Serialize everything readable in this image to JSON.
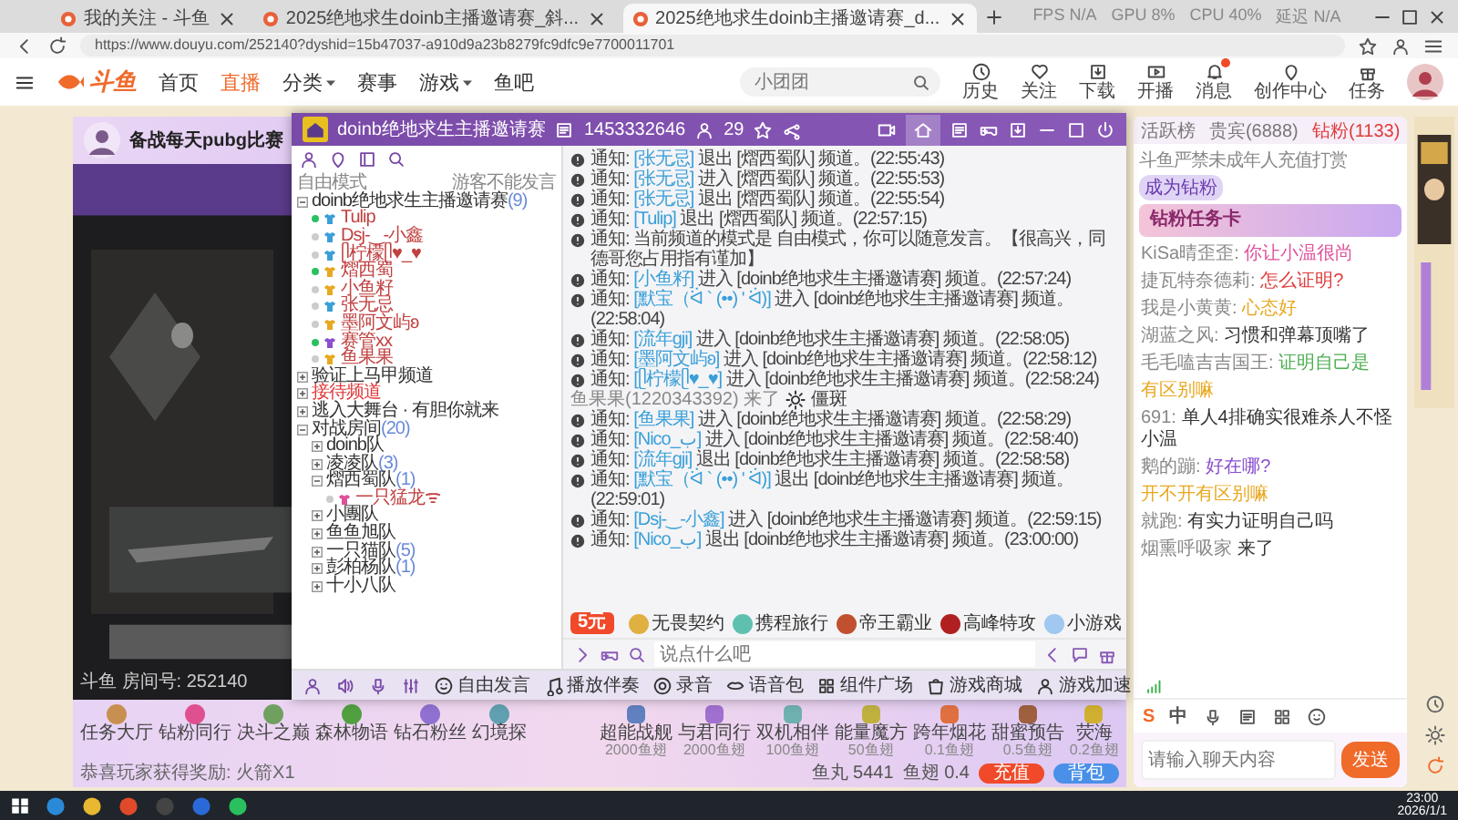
{
  "browser": {
    "tabs": [
      {
        "title": "我的关注 - 斗鱼",
        "selected": false
      },
      {
        "title": "2025绝地求生doinb主播邀请赛_斜...",
        "selected": false
      },
      {
        "title": "2025绝地求生doinb主播邀请赛_d...",
        "selected": true
      }
    ],
    "overlay_stats": [
      "FPS N/A",
      "GPU 8%",
      "CPU 40%",
      "延迟 N/A"
    ],
    "url": "https://www.douyu.com/252140?dyshid=15b47037-a910d9a23b8279fc9dfc9e7700011701"
  },
  "site": {
    "logo": "斗鱼",
    "nav": [
      {
        "label": "首页",
        "selected": false,
        "dropdown": false
      },
      {
        "label": "直播",
        "selected": true,
        "dropdown": false
      },
      {
        "label": "分类",
        "selected": false,
        "dropdown": true
      },
      {
        "label": "赛事",
        "selected": false,
        "dropdown": false
      },
      {
        "label": "游戏",
        "selected": false,
        "dropdown": true
      },
      {
        "label": "鱼吧",
        "selected": false,
        "dropdown": false
      }
    ],
    "search": {
      "placeholder": "小团团"
    },
    "actions": [
      {
        "label": "历史",
        "badge": false
      },
      {
        "label": "关注",
        "badge": false
      },
      {
        "label": "下载",
        "badge": false
      },
      {
        "label": "开播",
        "badge": false
      },
      {
        "label": "消息",
        "badge": true
      },
      {
        "label": "创作中心",
        "badge": false
      },
      {
        "label": "任务",
        "badge": false
      }
    ]
  },
  "room": {
    "streamer": "备战每天pubg比赛",
    "room_line": "斗鱼 房间号: 252140",
    "gifts_left": [
      "任务大厅",
      "钻粉同行",
      "决斗之巅",
      "森林物语",
      "钻石粉丝",
      "幻境探"
    ],
    "gifts_right": [
      {
        "name": "超能战舰",
        "price": "2000鱼翅"
      },
      {
        "name": "与君同行",
        "price": "2000鱼翅"
      },
      {
        "name": "双机相伴",
        "price": "100鱼翅"
      },
      {
        "name": "能量魔方",
        "price": "50鱼翅"
      },
      {
        "name": "跨年烟花",
        "price": "0.1鱼翅"
      },
      {
        "name": "甜蜜预告",
        "price": "0.5鱼翅"
      },
      {
        "name": "荧海",
        "price": "0.2鱼翅"
      }
    ],
    "reward_notice": "恭喜玩家获得奖励: 火箭X1",
    "fish_balls": "鱼丸 5441",
    "fish_fins": "鱼翅 0.4",
    "recharge": "充值",
    "backpack": "背包"
  },
  "voice_app": {
    "title": "doinb绝地求生主播邀请赛",
    "room_id": "1453332646",
    "online": "29",
    "mode": "自由模式",
    "mode_note": "游客不能发言",
    "channels": [
      {
        "kind": "channel",
        "name": "doinb绝地求生主播邀请赛",
        "count": "(9)",
        "expanded": true,
        "highlight": false,
        "children": [
          {
            "kind": "member",
            "name": "Tulip",
            "online": true,
            "color": "#3a9fd8"
          },
          {
            "kind": "member",
            "name": "Dsj-‿-小鑫",
            "online": false,
            "color": "#3a9fd8"
          },
          {
            "kind": "member",
            "name": "ᥫ柠檬ᥫ♥_♥",
            "online": false,
            "color": "#3a9fd8"
          },
          {
            "kind": "member",
            "name": "熠西蜀",
            "online": true,
            "color": "#e8a820"
          },
          {
            "kind": "member",
            "name": "小鱼籽",
            "online": false,
            "color": "#e8a820"
          },
          {
            "kind": "member",
            "name": "张无忌",
            "online": false,
            "color": "#3a9fd8"
          },
          {
            "kind": "member",
            "name": "墨阿文屿ʚ",
            "online": false,
            "color": "#e8a820"
          },
          {
            "kind": "member",
            "name": "赛管xx",
            "online": true,
            "color": "#8a4fd0"
          },
          {
            "kind": "member",
            "name": "鱼果果",
            "online": false,
            "color": "#e8a820"
          }
        ]
      },
      {
        "kind": "channel",
        "name": "验证上马甲频道",
        "expanded": false,
        "highlight": false
      },
      {
        "kind": "channel",
        "name": "接待频道",
        "expanded": false,
        "highlight": true
      },
      {
        "kind": "channel",
        "name": "逃入大舞台 · 有胆你就来",
        "expanded": false,
        "highlight": false
      },
      {
        "kind": "channel",
        "name": "对战房间",
        "count": "(20)",
        "expanded": true,
        "highlight": false,
        "children": [
          {
            "kind": "channel",
            "name": "doinb队",
            "expanded": false,
            "highlight": false
          },
          {
            "kind": "channel",
            "name": "凌凌队",
            "count": "(3)",
            "expanded": false,
            "highlight": false
          },
          {
            "kind": "channel",
            "name": "熠西蜀队",
            "count": "(1)",
            "expanded": true,
            "highlight": false,
            "children": [
              {
                "kind": "member",
                "name": "一只猛龙ᯤ",
                "online": false,
                "color": "#e0509a"
              }
            ]
          },
          {
            "kind": "channel",
            "name": "小團队",
            "expanded": false,
            "highlight": false
          },
          {
            "kind": "channel",
            "name": "鱼鱼旭队",
            "expanded": false,
            "highlight": false
          },
          {
            "kind": "channel",
            "name": "一只猫队",
            "count": "(5)",
            "expanded": false,
            "highlight": false
          },
          {
            "kind": "channel",
            "name": "彭柏杨队",
            "count": "(1)",
            "expanded": false,
            "highlight": false
          },
          {
            "kind": "channel",
            "name": "十小八队",
            "expanded": false,
            "highlight": false
          }
        ]
      }
    ],
    "messages": [
      {
        "kind": "notice",
        "label": "通知:",
        "user": "[张无忌]",
        "text": "退出 [熠西蜀队] 频道。(22:55:43)"
      },
      {
        "kind": "notice",
        "label": "通知:",
        "user": "[张无忌]",
        "text": "进入 [熠西蜀队] 频道。(22:55:53)"
      },
      {
        "kind": "notice",
        "label": "通知:",
        "user": "[张无忌]",
        "text": "退出 [熠西蜀队] 频道。(22:55:54)"
      },
      {
        "kind": "notice",
        "label": "通知:",
        "user": "[Tulip]",
        "text": "退出 [熠西蜀队] 频道。(22:57:15)"
      },
      {
        "kind": "system",
        "label": "通知:",
        "text": "当前频道的模式是 自由模式，你可以随意发言。【很高兴，同德哥您占用指有谨加】"
      },
      {
        "kind": "notice",
        "label": "通知:",
        "user": "[小鱼籽]",
        "text": "进入 [doinb绝地求生主播邀请赛] 频道。(22:57:24)"
      },
      {
        "kind": "notice",
        "label": "通知:",
        "user": "[默宝（ᐛ ` (••) ' ᐛ)]",
        "text": "进入 [doinb绝地求生主播邀请赛] 频道。(22:58:04)"
      },
      {
        "kind": "notice",
        "label": "通知:",
        "user": "[流年gji]",
        "text": "进入 [doinb绝地求生主播邀请赛] 频道。(22:58:05)"
      },
      {
        "kind": "notice",
        "label": "通知:",
        "user": "[墨阿文屿ʚ]",
        "text": "进入 [doinb绝地求生主播邀请赛] 频道。(22:58:12)"
      },
      {
        "kind": "notice",
        "label": "通知:",
        "user": "[ᥫ柠檬ᥫ♥_♥]",
        "text": "进入 [doinb绝地求生主播邀请赛] 频道。(22:58:24)"
      },
      {
        "kind": "join",
        "user": "鱼果果(1220343392)",
        "text": "来了",
        "extra": "僵斑"
      },
      {
        "kind": "notice",
        "label": "通知:",
        "user": "[鱼果果]",
        "text": "进入 [doinb绝地求生主播邀请赛] 频道。(22:58:29)"
      },
      {
        "kind": "notice",
        "label": "通知:",
        "user": "[Nico_ب]",
        "text": "进入 [doinb绝地求生主播邀请赛] 频道。(22:58:40)"
      },
      {
        "kind": "notice",
        "label": "通知:",
        "user": "[流年gji]",
        "text": "退出 [doinb绝地求生主播邀请赛] 频道。(22:58:58)"
      },
      {
        "kind": "notice",
        "label": "通知:",
        "user": "[默宝（ᐛ ` (••) ' ᐛ)]",
        "text": "退出 [doinb绝地求生主播邀请赛] 频道。(22:59:01)"
      },
      {
        "kind": "notice",
        "label": "通知:",
        "user": "[Dsj-‿-小鑫]",
        "text": "进入 [doinb绝地求生主播邀请赛] 频道。(22:59:15)"
      },
      {
        "kind": "notice",
        "label": "通知:",
        "user": "[Nico_ب]",
        "text": "退出 [doinb绝地求生主播邀请赛] 频道。(23:00:00)"
      }
    ],
    "input_placeholder": "说点什么吧",
    "coupon": "5元",
    "mini_apps": [
      "无畏契约",
      "携程旅行",
      "帝王霸业",
      "高峰特攻",
      "小游戏"
    ],
    "toolbar": [
      "自由发言",
      "播放伴奏",
      "录音",
      "语音包",
      "组件广场",
      "游戏商城",
      "游戏加速"
    ]
  },
  "chat": {
    "tabs": [
      {
        "label": "活跃榜",
        "selected": false
      },
      {
        "label": "贵宾(6888)",
        "selected": false
      },
      {
        "label": "钻粉(1133)",
        "selected": true
      }
    ],
    "notice": "斗鱼严禁未成年人充值打赏",
    "join_fan": "成为钻粉",
    "banner": "钻粉任务卡",
    "messages": [
      {
        "user": "KiSa晴歪歪:",
        "text": "你让小温很尚",
        "color": "#e0509a"
      },
      {
        "user": "捷瓦特奈德莉:",
        "text": "怎么证明?",
        "color": "#e03a3a"
      },
      {
        "user": "我是小黄黄:",
        "text": "心态好",
        "color": "#e8a820"
      },
      {
        "user": "湖蓝之风:",
        "text": "习惯和弹幕顶嘴了",
        "color": "#333333"
      },
      {
        "user": "毛毛嗑吉吉国王:",
        "text": "证明自己是",
        "color": "#4caf50"
      },
      {
        "text": "有区别嘛",
        "color": "#e8a820"
      },
      {
        "user": "691:",
        "text": "单人4排确实很难杀人不怪小温",
        "color": "#333333"
      },
      {
        "user": "鹅的蹦:",
        "text": "好在哪?",
        "color": "#8a4fd0"
      },
      {
        "text": "开不开有区别嘛",
        "color": "#e8a820"
      },
      {
        "user": "就跑:",
        "text": "有实力证明自己吗",
        "color": "#333333"
      },
      {
        "user": "烟熏呼吸家",
        "text": "来了",
        "color": "#333333"
      }
    ],
    "tools": [
      "S",
      "中"
    ],
    "input_placeholder": "请输入聊天内容",
    "send": "发送"
  },
  "taskbar": {
    "time": "23:00",
    "date": "2026/1/1"
  }
}
